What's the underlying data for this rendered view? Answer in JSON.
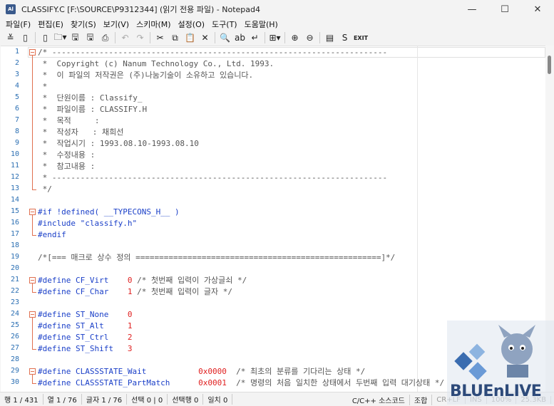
{
  "window": {
    "app_icon_text": "Al",
    "title": "CLASSIFY.C [F:\\SOURCE\\P9312344] (읽기 전용 파일) - Notepad4",
    "minimize_glyph": "—",
    "maximize_glyph": "☐",
    "close_glyph": "✕"
  },
  "menu": {
    "items": [
      "파일(F)",
      "편집(E)",
      "찾기(S)",
      "보기(V)",
      "스키마(M)",
      "설정(O)",
      "도구(T)",
      "도움말(H)"
    ]
  },
  "toolbar": {
    "buttons": [
      {
        "name": "dropdown-menu-icon",
        "glyph": "≚"
      },
      {
        "name": "new-file-icon",
        "glyph": "▯"
      },
      {
        "name": "new-window-icon",
        "glyph": "▯"
      },
      {
        "name": "open-folder-icon",
        "glyph": "🗀▾"
      },
      {
        "name": "save-icon",
        "glyph": "🖫"
      },
      {
        "name": "save-as-icon",
        "glyph": "🖫"
      },
      {
        "name": "print-icon",
        "glyph": "⎙"
      },
      {
        "name": "undo-icon",
        "glyph": "↶",
        "dim": true
      },
      {
        "name": "redo-icon",
        "glyph": "↷",
        "dim": true
      },
      {
        "name": "cut-icon",
        "glyph": "✂"
      },
      {
        "name": "copy-icon",
        "glyph": "⧉"
      },
      {
        "name": "paste-icon",
        "glyph": "📋"
      },
      {
        "name": "delete-icon",
        "glyph": "✕"
      },
      {
        "name": "find-icon",
        "glyph": "🔍"
      },
      {
        "name": "replace-icon",
        "glyph": "ab"
      },
      {
        "name": "word-wrap-icon",
        "glyph": "↵"
      },
      {
        "name": "tree-icon",
        "glyph": "⊞▾"
      },
      {
        "name": "zoom-in-icon",
        "glyph": "⊕"
      },
      {
        "name": "zoom-out-icon",
        "glyph": "⊖"
      },
      {
        "name": "view-icon",
        "glyph": "▤"
      },
      {
        "name": "scheme-icon",
        "glyph": "S"
      },
      {
        "name": "exit-icon",
        "glyph": "EXIT"
      }
    ]
  },
  "editor": {
    "lines": [
      {
        "n": "1",
        "t": "/* -----------------------------------------------------------------------",
        "k": "comment"
      },
      {
        "n": "2",
        "t": " *  Copyright (c) Nanum Technology Co., Ltd. 1993.",
        "k": "comment"
      },
      {
        "n": "3",
        "t": " *  이 파일의 저작권은 (주)나눔기술이 소유하고 있습니다.",
        "k": "comment"
      },
      {
        "n": "4",
        "t": " *",
        "k": "comment"
      },
      {
        "n": "5",
        "t": " *  단원이름 : Classify_",
        "k": "comment"
      },
      {
        "n": "6",
        "t": " *  파일이름 : CLASSIFY.H",
        "k": "comment"
      },
      {
        "n": "7",
        "t": " *  목적     :",
        "k": "comment"
      },
      {
        "n": "8",
        "t": " *  작성자   : 채희선",
        "k": "comment"
      },
      {
        "n": "9",
        "t": " *  작업시기 : 1993.08.10-1993.08.10",
        "k": "comment"
      },
      {
        "n": "10",
        "t": " *  수정내용 :",
        "k": "comment"
      },
      {
        "n": "11",
        "t": " *  참고내용 :",
        "k": "comment"
      },
      {
        "n": "12",
        "t": " * -----------------------------------------------------------------------",
        "k": "comment"
      },
      {
        "n": "13",
        "t": " */",
        "k": "comment"
      },
      {
        "n": "14",
        "t": "",
        "k": "plain"
      },
      {
        "n": "15",
        "t": "#if !defined( __TYPECONS_H__ )",
        "k": "pre"
      },
      {
        "n": "16",
        "t": "#include \"classify.h\"",
        "k": "pre"
      },
      {
        "n": "17",
        "t": "#endif",
        "k": "pre"
      },
      {
        "n": "18",
        "t": "",
        "k": "plain"
      },
      {
        "n": "19",
        "t": "/*[=== 매크로 상수 정의 ====================================================]*/",
        "k": "comment"
      },
      {
        "n": "20",
        "t": "",
        "k": "plain"
      },
      {
        "n": "21",
        "parts": [
          [
            "#define CF_Virt    ",
            "pre"
          ],
          [
            "0",
            "num"
          ],
          [
            " /* 첫번째 입력이 가상글쇠 */",
            "comment"
          ]
        ]
      },
      {
        "n": "22",
        "parts": [
          [
            "#define CF_Char    ",
            "pre"
          ],
          [
            "1",
            "num"
          ],
          [
            " /* 첫번째 입력이 글자 */",
            "comment"
          ]
        ]
      },
      {
        "n": "23",
        "t": "",
        "k": "plain"
      },
      {
        "n": "24",
        "parts": [
          [
            "#define ST_None    ",
            "pre"
          ],
          [
            "0",
            "num"
          ]
        ]
      },
      {
        "n": "25",
        "parts": [
          [
            "#define ST_Alt     ",
            "pre"
          ],
          [
            "1",
            "num"
          ]
        ]
      },
      {
        "n": "26",
        "parts": [
          [
            "#define ST_Ctrl    ",
            "pre"
          ],
          [
            "2",
            "num"
          ]
        ]
      },
      {
        "n": "27",
        "parts": [
          [
            "#define ST_Shift   ",
            "pre"
          ],
          [
            "3",
            "num"
          ]
        ]
      },
      {
        "n": "28",
        "t": "",
        "k": "plain"
      },
      {
        "n": "29",
        "parts": [
          [
            "#define CLASSSTATE_Wait           ",
            "pre"
          ],
          [
            "0x0000",
            "num"
          ],
          [
            "  /* 최초의 분류를 기다리는 상태 */",
            "comment"
          ]
        ]
      },
      {
        "n": "30",
        "parts": [
          [
            "#define CLASSSTATE_PartMatch      ",
            "pre"
          ],
          [
            "0x0001",
            "num"
          ],
          [
            "  /* 명령의 처음 일치한 상태에서 두번째 입력 대기상태 */",
            "comment"
          ]
        ]
      }
    ]
  },
  "status": {
    "line": "행 1 / 431",
    "column": "열 1 / 76",
    "char": "글자 1 / 76",
    "selection": "선택 0 | 0",
    "selected_lines": "선택행 0",
    "matches": "일치 0",
    "lexer": "C/C++ 소스코드",
    "ime": "조합",
    "eol": "CR+LF",
    "ins": "INS",
    "zoom": "100%",
    "size": "25.3KB"
  },
  "watermark": {
    "text": "BLUEnLIVE"
  }
}
